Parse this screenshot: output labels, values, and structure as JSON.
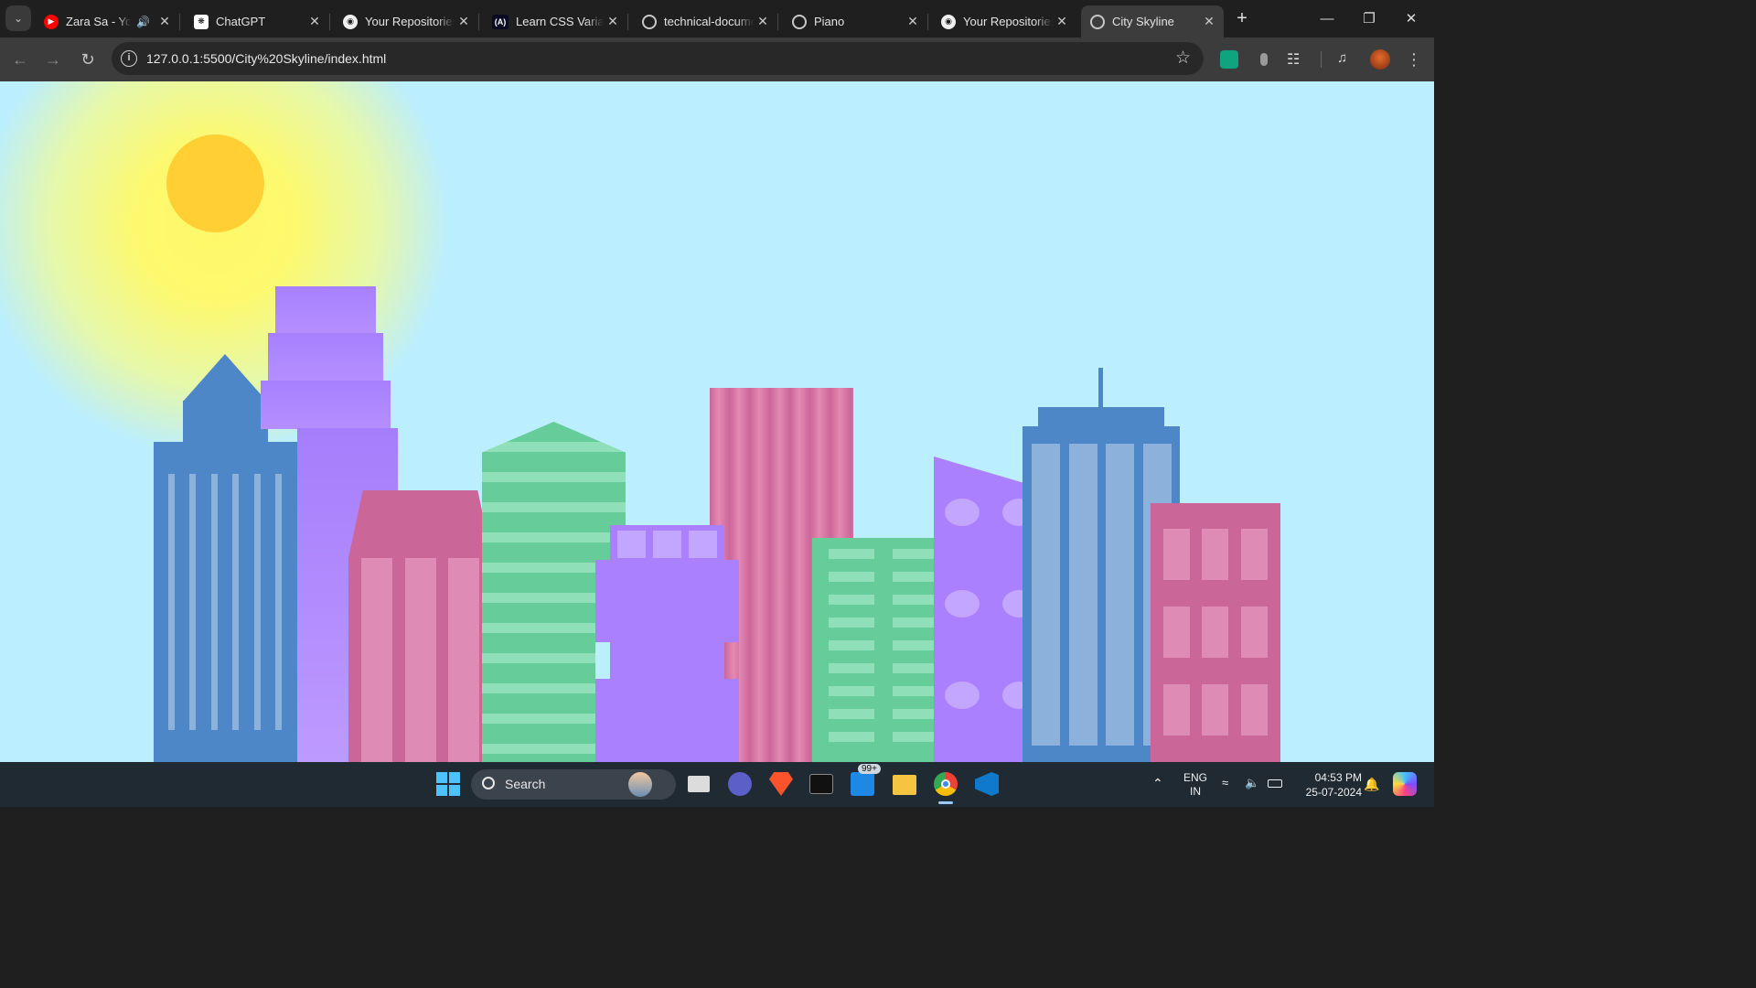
{
  "browser": {
    "tabs": [
      {
        "title": "Zara Sa - You",
        "icon": "youtube-icon",
        "audio": true,
        "active": false
      },
      {
        "title": "ChatGPT",
        "icon": "chatgpt-icon",
        "active": false
      },
      {
        "title": "Your Repositories",
        "icon": "github-icon",
        "active": false
      },
      {
        "title": "Learn CSS Variables",
        "icon": "freecodecamp-icon",
        "active": false
      },
      {
        "title": "technical-documentation",
        "icon": "globe-icon",
        "active": false
      },
      {
        "title": "Piano",
        "icon": "globe-icon",
        "active": false
      },
      {
        "title": "Your Repositories",
        "icon": "github-icon",
        "active": false
      },
      {
        "title": "City Skyline",
        "icon": "globe-icon",
        "active": true
      }
    ],
    "new_tab_label": "+",
    "url": "127.0.0.1:5500/City%20Skyline/index.html",
    "accent": "#3c3c3c"
  },
  "page": {
    "sky_color": "#bbeefe",
    "sun_color": "#ffcf33",
    "building_colors": {
      "blue": "#4d87c8",
      "purple": "#aa80ff",
      "pink": "#cb6699",
      "green": "#66cc99",
      "window_blue": "#8cb2db",
      "window_pink": "#de8bb5",
      "window_green": "#8fdfb8"
    }
  },
  "taskbar": {
    "search_label": "Search",
    "mail_badge": "99+",
    "language": "ENG",
    "region": "IN",
    "time": "04:53 PM",
    "date": "25-07-2024"
  }
}
